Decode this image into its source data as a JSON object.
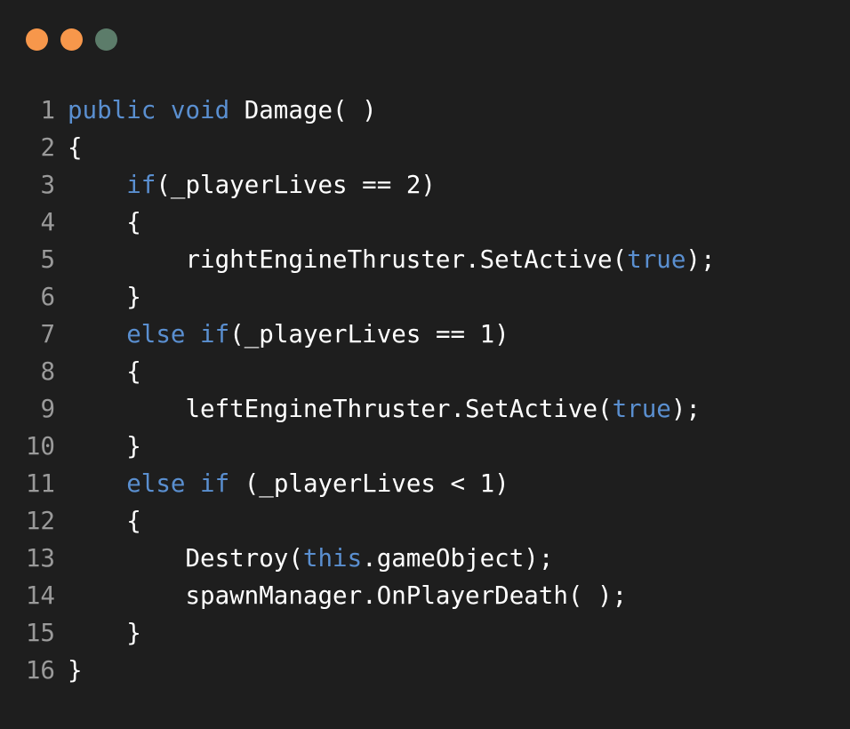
{
  "window": {
    "background": "#1e1e1e",
    "traffic_lights": [
      {
        "name": "close",
        "color": "#f7974b"
      },
      {
        "name": "minimize",
        "color": "#f7974b"
      },
      {
        "name": "maximize",
        "color": "#5c7c6a"
      }
    ]
  },
  "colors": {
    "keyword": "#5a8fd0",
    "text": "#ffffff",
    "line_number": "#9a9a9a"
  },
  "code": {
    "lines": [
      {
        "number": "1",
        "tokens": [
          {
            "t": "kw",
            "v": "public"
          },
          {
            "t": "tx",
            "v": " "
          },
          {
            "t": "kw",
            "v": "void"
          },
          {
            "t": "tx",
            "v": " Damage( )"
          }
        ]
      },
      {
        "number": "2",
        "tokens": [
          {
            "t": "tx",
            "v": "{"
          }
        ]
      },
      {
        "number": "3",
        "tokens": [
          {
            "t": "tx",
            "v": "    "
          },
          {
            "t": "kw",
            "v": "if"
          },
          {
            "t": "tx",
            "v": "(_playerLives == 2)"
          }
        ]
      },
      {
        "number": "4",
        "tokens": [
          {
            "t": "tx",
            "v": "    {"
          }
        ]
      },
      {
        "number": "5",
        "tokens": [
          {
            "t": "tx",
            "v": "        rightEngineThruster.SetActive("
          },
          {
            "t": "kw",
            "v": "true"
          },
          {
            "t": "tx",
            "v": ");"
          }
        ]
      },
      {
        "number": "6",
        "tokens": [
          {
            "t": "tx",
            "v": "    }"
          }
        ]
      },
      {
        "number": "7",
        "tokens": [
          {
            "t": "tx",
            "v": "    "
          },
          {
            "t": "kw",
            "v": "else"
          },
          {
            "t": "tx",
            "v": " "
          },
          {
            "t": "kw",
            "v": "if"
          },
          {
            "t": "tx",
            "v": "(_playerLives == 1)"
          }
        ]
      },
      {
        "number": "8",
        "tokens": [
          {
            "t": "tx",
            "v": "    {"
          }
        ]
      },
      {
        "number": "9",
        "tokens": [
          {
            "t": "tx",
            "v": "        leftEngineThruster.SetActive("
          },
          {
            "t": "kw",
            "v": "true"
          },
          {
            "t": "tx",
            "v": ");"
          }
        ]
      },
      {
        "number": "10",
        "tokens": [
          {
            "t": "tx",
            "v": "    }"
          }
        ]
      },
      {
        "number": "11",
        "tokens": [
          {
            "t": "tx",
            "v": "    "
          },
          {
            "t": "kw",
            "v": "else"
          },
          {
            "t": "tx",
            "v": " "
          },
          {
            "t": "kw",
            "v": "if"
          },
          {
            "t": "tx",
            "v": " (_playerLives < 1)"
          }
        ]
      },
      {
        "number": "12",
        "tokens": [
          {
            "t": "tx",
            "v": "    {"
          }
        ]
      },
      {
        "number": "13",
        "tokens": [
          {
            "t": "tx",
            "v": "        Destroy("
          },
          {
            "t": "kw",
            "v": "this"
          },
          {
            "t": "tx",
            "v": ".gameObject);"
          }
        ]
      },
      {
        "number": "14",
        "tokens": [
          {
            "t": "tx",
            "v": "        spawnManager.OnPlayerDeath( );"
          }
        ]
      },
      {
        "number": "15",
        "tokens": [
          {
            "t": "tx",
            "v": "    }"
          }
        ]
      },
      {
        "number": "16",
        "tokens": [
          {
            "t": "tx",
            "v": "}"
          }
        ]
      }
    ]
  }
}
